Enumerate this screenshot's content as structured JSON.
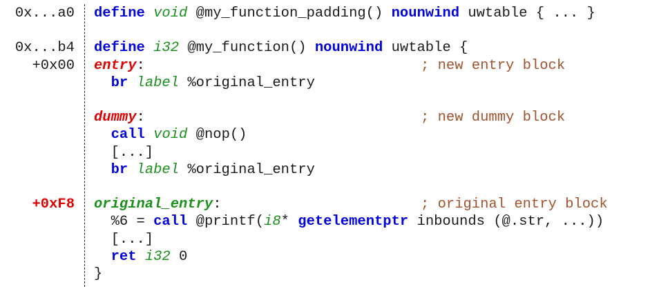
{
  "lines": [
    {
      "addr": "0x...a0",
      "parts": [
        {
          "t": "define",
          "c": "kw"
        },
        {
          "t": " "
        },
        {
          "t": "void",
          "c": "ty"
        },
        {
          "t": " @my_function_padding() "
        },
        {
          "t": "nounwind",
          "c": "kw"
        },
        {
          "t": " uwtable { ... }"
        }
      ]
    },
    {
      "addr": "",
      "parts": []
    },
    {
      "addr": "0x...b4",
      "parts": [
        {
          "t": "define",
          "c": "kw"
        },
        {
          "t": " "
        },
        {
          "t": "i32",
          "c": "ty"
        },
        {
          "t": " @my_function() "
        },
        {
          "t": "nounwind",
          "c": "kw"
        },
        {
          "t": " uwtable {"
        }
      ]
    },
    {
      "addr": "+0x00",
      "parts": [
        {
          "t": "entry",
          "c": "lbl-red"
        },
        {
          "t": ":"
        }
      ],
      "comment": "; new entry block"
    },
    {
      "addr": "",
      "parts": [
        {
          "t": "  "
        },
        {
          "t": "br",
          "c": "kw"
        },
        {
          "t": " "
        },
        {
          "t": "label",
          "c": "ty"
        },
        {
          "t": " %original_entry"
        }
      ]
    },
    {
      "addr": "",
      "parts": []
    },
    {
      "addr": "",
      "parts": [
        {
          "t": "dummy",
          "c": "lbl-red"
        },
        {
          "t": ":"
        }
      ],
      "comment": "; new dummy block"
    },
    {
      "addr": "",
      "parts": [
        {
          "t": "  "
        },
        {
          "t": "call",
          "c": "kw"
        },
        {
          "t": " "
        },
        {
          "t": "void",
          "c": "ty"
        },
        {
          "t": " @nop()"
        }
      ]
    },
    {
      "addr": "",
      "parts": [
        {
          "t": "  [...]"
        }
      ]
    },
    {
      "addr": "",
      "parts": [
        {
          "t": "  "
        },
        {
          "t": "br",
          "c": "kw"
        },
        {
          "t": " "
        },
        {
          "t": "label",
          "c": "ty"
        },
        {
          "t": " %original_entry"
        }
      ]
    },
    {
      "addr": "",
      "parts": []
    },
    {
      "addr": "+0xF8",
      "addr_highlight": true,
      "parts": [
        {
          "t": "original_entry",
          "c": "lbl-grn"
        },
        {
          "t": ":"
        }
      ],
      "comment": "; original entry block"
    },
    {
      "addr": "",
      "parts": [
        {
          "t": "  %6 = "
        },
        {
          "t": "call",
          "c": "kw"
        },
        {
          "t": " @printf("
        },
        {
          "t": "i8",
          "c": "ty"
        },
        {
          "t": "* "
        },
        {
          "t": "getelementptr",
          "c": "kw"
        },
        {
          "t": " inbounds (@.str, ...))"
        }
      ]
    },
    {
      "addr": "",
      "parts": [
        {
          "t": "  [...]"
        }
      ]
    },
    {
      "addr": "",
      "parts": [
        {
          "t": "  "
        },
        {
          "t": "ret",
          "c": "kw"
        },
        {
          "t": " "
        },
        {
          "t": "i32",
          "c": "ty"
        },
        {
          "t": " 0"
        }
      ]
    },
    {
      "addr": "",
      "parts": [
        {
          "t": "}"
        }
      ]
    }
  ],
  "colors": {
    "keyword": "#0000e0",
    "type": "#1a8f1a",
    "label_new": "#e00000",
    "label_original": "#1a8f1a",
    "comment": "#a0522d",
    "address_highlight": "#e00000"
  }
}
